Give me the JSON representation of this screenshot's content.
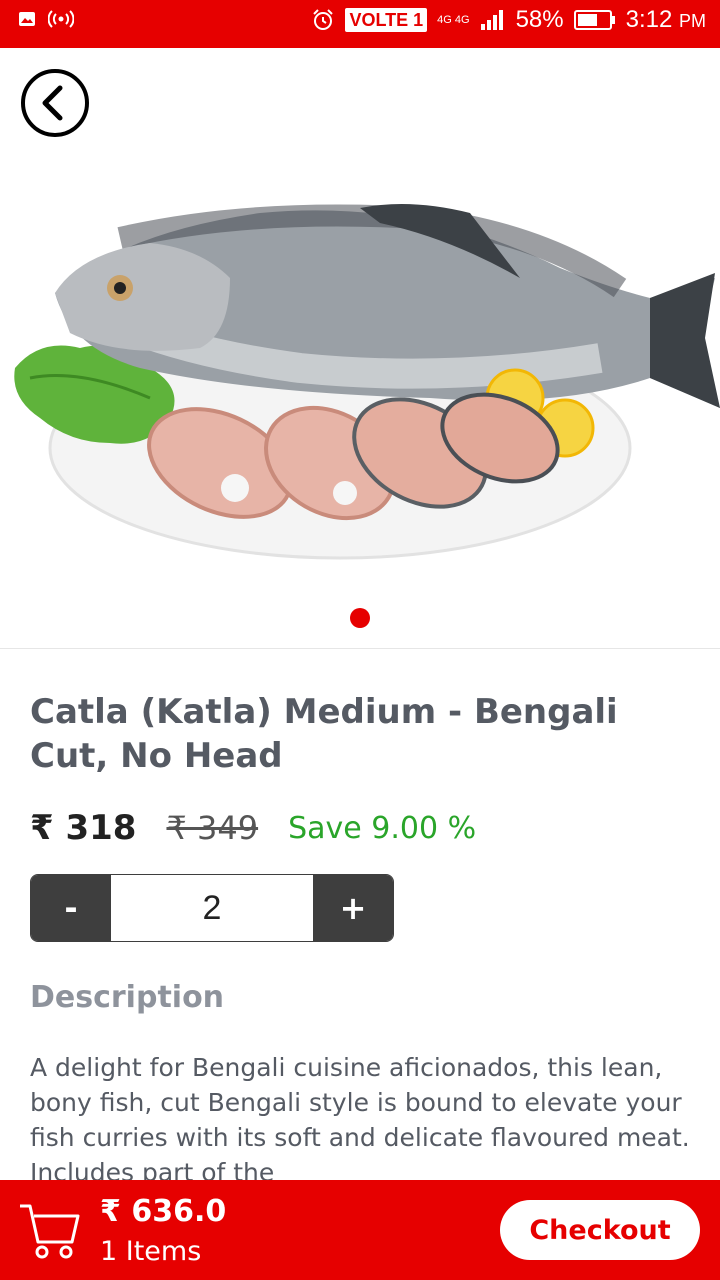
{
  "status_bar": {
    "network": "VOLTE 1",
    "signal": "4G 4G",
    "battery": "58%",
    "time": "3:12",
    "ampm": "PM",
    "icons": [
      "image-icon",
      "hotspot-icon",
      "alarm-icon",
      "signal-icon",
      "battery-icon"
    ]
  },
  "product": {
    "image_alt": "Catla fish with Bengali cut slices on a plate",
    "title": "Catla (Katla) Medium - Bengali Cut, No Head",
    "price": "₹ 318",
    "mrp": "₹ 349",
    "save": "Save 9.00 %",
    "quantity": "2",
    "decrement_label": "-",
    "increment_label": "+"
  },
  "description": {
    "heading": "Description",
    "text": "A delight for Bengali cuisine aficionados, this lean, bony fish, cut Bengali style is bound to elevate your fish curries with its soft and delicate flavoured meat. Includes part of the"
  },
  "cart": {
    "total": "₹ 636.0",
    "items": "1 Items",
    "checkout_label": "Checkout"
  },
  "colors": {
    "accent": "#e60000",
    "save_green": "#2aa52a",
    "dark_button": "#3e3e3e"
  }
}
